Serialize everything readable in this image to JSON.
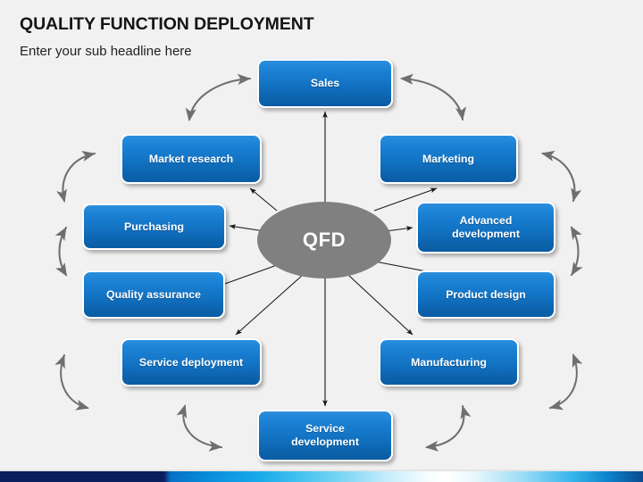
{
  "header": {
    "title": "QUALITY FUNCTION DEPLOYMENT",
    "subtitle": "Enter your sub headline here"
  },
  "diagram": {
    "center": {
      "label": "QFD",
      "shape": "ellipse",
      "fill": "#808080",
      "text_color": "#ffffff"
    },
    "node_style": {
      "fill_top": "#2b8ede",
      "fill_bottom": "#0a5ca3",
      "border": "#ffffff",
      "text_color": "#ffffff"
    },
    "arrow_color": "#1a1a1a",
    "cycle_arrow_color": "#6f6f6f",
    "nodes": [
      {
        "id": "sales",
        "label": "Sales",
        "position": "top"
      },
      {
        "id": "marketing",
        "label": "Marketing",
        "position": "upper-right"
      },
      {
        "id": "advanced-development",
        "label": "Advanced\ndevelopment",
        "line1": "Advanced",
        "line2": "development",
        "position": "right-upper"
      },
      {
        "id": "product-design",
        "label": "Product design",
        "position": "right-lower"
      },
      {
        "id": "manufacturing",
        "label": "Manufacturing",
        "position": "lower-right"
      },
      {
        "id": "service-development",
        "label": "Service\ndevelopment",
        "line1": "Service",
        "line2": "development",
        "position": "bottom"
      },
      {
        "id": "service-deployment",
        "label": "Service deployment",
        "position": "lower-left"
      },
      {
        "id": "quality-assurance",
        "label": "Quality assurance",
        "position": "left-lower"
      },
      {
        "id": "purchasing",
        "label": "Purchasing",
        "position": "left-upper"
      },
      {
        "id": "market-research",
        "label": "Market research",
        "position": "upper-left"
      }
    ]
  },
  "footer": {
    "band_colors": [
      "#0b1f5e",
      "#0b8fdd",
      "#3fc0f0",
      "#ffffff",
      "#35b5ec",
      "#0a4a8e"
    ]
  }
}
